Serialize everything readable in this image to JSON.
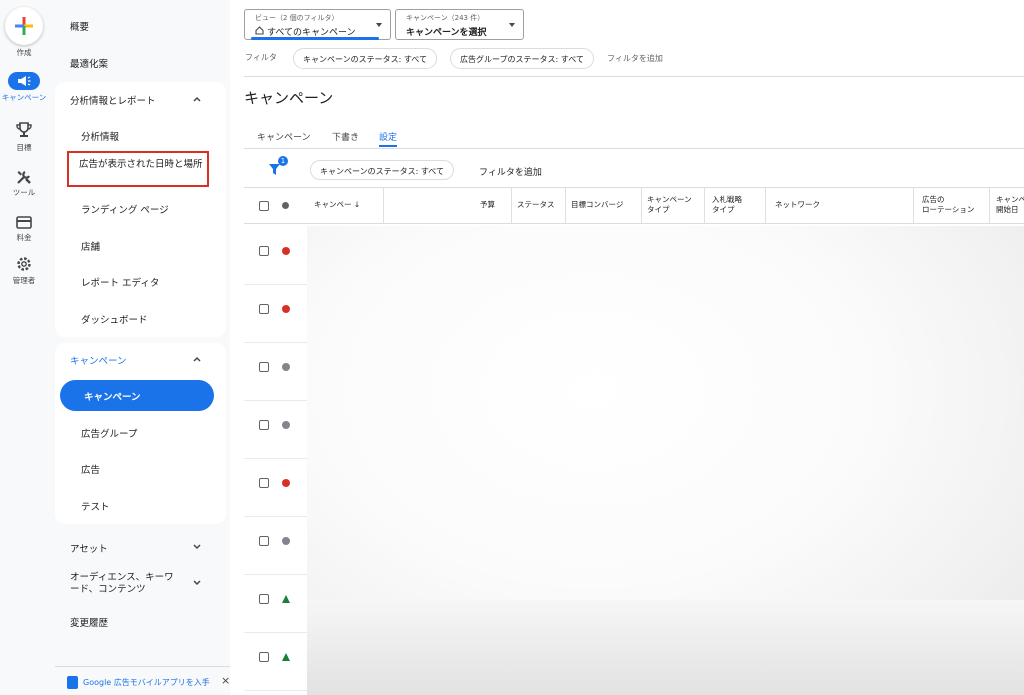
{
  "rail": {
    "create_label": "作成",
    "campaign_label": "キャンペーン",
    "goals_label": "目標",
    "tools_label": "ツール",
    "billing_label": "料金",
    "admin_label": "管理者"
  },
  "sidebar": {
    "overview": "概要",
    "recommendations": "最適化案",
    "insights_section": {
      "header": "分析情報とレポート",
      "items": [
        "分析情報",
        "広告が表示された日時と場所",
        "ランディング ページ",
        "店舗",
        "レポート エディタ",
        "ダッシュボード"
      ]
    },
    "campaigns_section": {
      "header": "キャンペーン",
      "items": [
        "キャンペーン",
        "広告グループ",
        "広告",
        "テスト"
      ]
    },
    "assets": "アセット",
    "audiences": "オーディエンス、キーワード、コンテンツ",
    "change_history": "変更履歴",
    "app_promo": "Google 広告モバイルアプリを入手",
    "close_symbol": "×"
  },
  "toolbar": {
    "view_label": "ビュー（2 個のフィルタ）",
    "view_value": "すべてのキャンペーン",
    "campaign_select_label": "キャンペーン（243 件）",
    "campaign_select_value": "キャンペーンを選択"
  },
  "filters": {
    "label": "フィルタ",
    "chips": [
      "キャンペーンのステータス: すべて",
      "広告グループのステータス: すべて"
    ],
    "add": "フィルタを追加"
  },
  "main": {
    "title": "キャンペーン",
    "tabs": [
      "キャンペーン",
      "下書き",
      "設定"
    ],
    "filter_count": "1",
    "filter_chip": "キャンペーンのステータス: すべて",
    "add_filter": "フィルタを追加"
  },
  "table": {
    "headers": {
      "campaign": "キャンペー ↓",
      "budget": "予算",
      "status": "ステータス",
      "goal": "目標コンバージ",
      "type": "キャンペーン\nタイプ",
      "bidding": "入札戦略\nタイプ",
      "network": "ネットワーク",
      "rotation": "広告の\nローテーション",
      "start": "キャンペ\n開始日"
    },
    "row_status": [
      "error",
      "error",
      "paused",
      "paused",
      "error",
      "paused",
      "experiment",
      "experiment"
    ]
  },
  "colors": {
    "accent": "#1a73e8",
    "error": "#d93025",
    "paused": "#80868b",
    "experiment": "#188038",
    "highlight_box": "#d93025"
  }
}
